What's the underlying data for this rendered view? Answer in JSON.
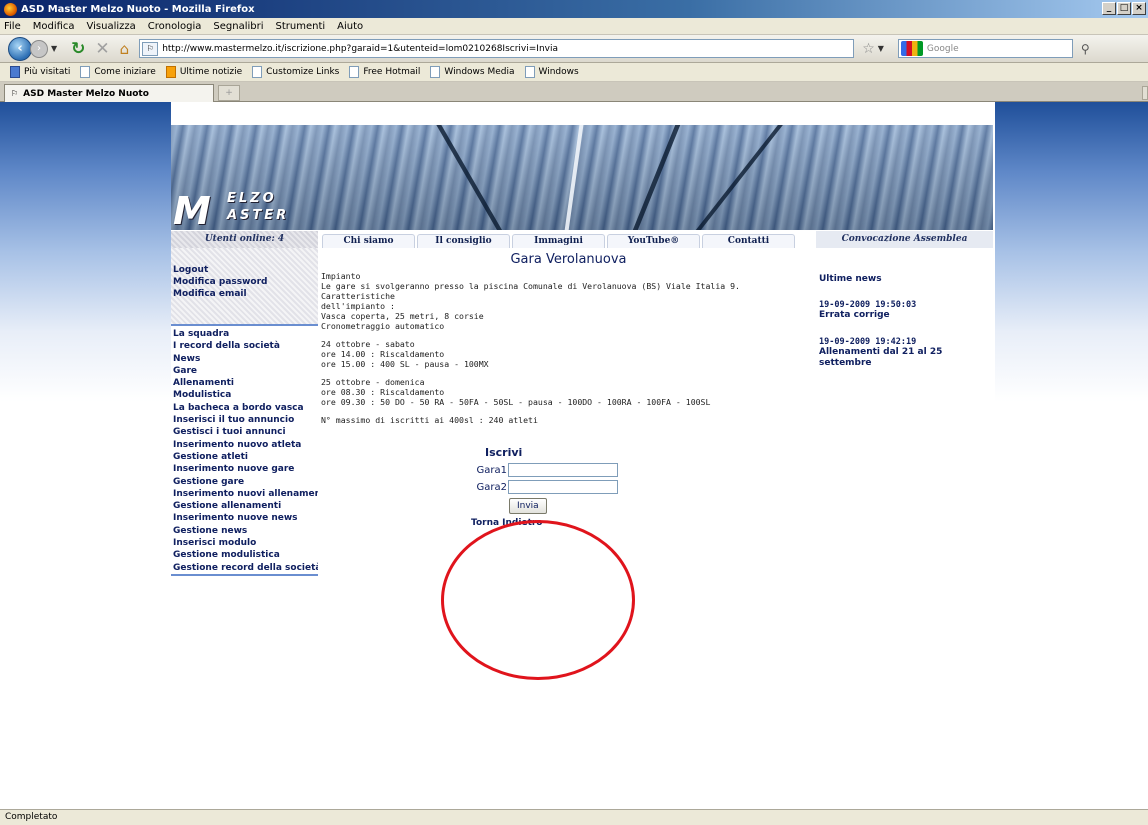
{
  "window": {
    "title": "ASD Master Melzo Nuoto - Mozilla Firefox"
  },
  "menu": [
    "File",
    "Modifica",
    "Visualizza",
    "Cronologia",
    "Segnalibri",
    "Strumenti",
    "Aiuto"
  ],
  "nav": {
    "url": "http://www.mastermelzo.it/iscrizione.php?garaid=1&utenteid=lom0210268Iscrivi=Invia",
    "search_placeholder": "Google"
  },
  "bookmarks": [
    "Più visitati",
    "Come iniziare",
    "Ultime notizie",
    "Customize Links",
    "Free Hotmail",
    "Windows Media",
    "Windows"
  ],
  "tab": {
    "label": "ASD Master Melzo Nuoto"
  },
  "site": {
    "users_online": "Utenti online: 4",
    "nav_tabs": [
      "Chi siamo",
      "Il consiglio",
      "Immagini",
      "YouTube®",
      "Contatti"
    ],
    "convocazione": "Convocazione Assemblea",
    "user_links": [
      "Logout",
      "Modifica password",
      "Modifica email"
    ],
    "menu_links": [
      "La squadra",
      "I record della società",
      "News",
      "Gare",
      "Allenamenti",
      "Modulistica",
      "La bacheca a bordo vasca",
      "Inserisci il tuo annuncio",
      "Gestisci i tuoi annunci",
      "Inserimento nuovo atleta",
      "Gestione atleti",
      "Inserimento nuove gare",
      "Gestione gare",
      "Inserimento nuovi allenamenti",
      "Gestione allenamenti",
      "Inserimento nuove news",
      "Gestione news",
      "Inserisci modulo",
      "Gestione modulistica",
      "Gestione record della società"
    ],
    "page_title": "Gara Verolanuova",
    "desc": {
      "p1": "Impianto\nLe gare si svolgeranno presso la piscina Comunale di Verolanuova (BS) Viale Italia 9. Caratteristiche\ndell'impianto :\nVasca coperta, 25 metri, 8 corsie\nCronometraggio automatico",
      "p2": "24 ottobre - sabato\nore 14.00 : Riscaldamento\nore 15.00 : 400 SL - pausa - 100MX",
      "p3": "25 ottobre - domenica\nore 08.30 : Riscaldamento\nore 09.30 : 50 DO - 50 RA - 50FA - 50SL - pausa - 100DO - 100RA - 100FA - 100SL",
      "p4": "N° massimo di iscritti ai 400sl : 240 atleti"
    },
    "news": {
      "heading": "Ultime news",
      "items": [
        {
          "date": "19-09-2009 19:50:03",
          "title": "Errata corrige"
        },
        {
          "date": "19-09-2009 19:42:19",
          "title": "Allenamenti dal 21 al 25 settembre"
        }
      ]
    },
    "form": {
      "title": "Iscrivi",
      "gara1_label": "Gara1",
      "gara1_value": "",
      "gara2_label": "Gara2",
      "gara2_value": "",
      "submit_label": "Invia",
      "back_link": "Torna Indietro"
    },
    "logo": {
      "line1": "ELZO",
      "line2": "ASTER"
    }
  },
  "status": {
    "text": "Completato"
  },
  "colors": {
    "highlight": "#e0141c",
    "link": "#102060"
  }
}
